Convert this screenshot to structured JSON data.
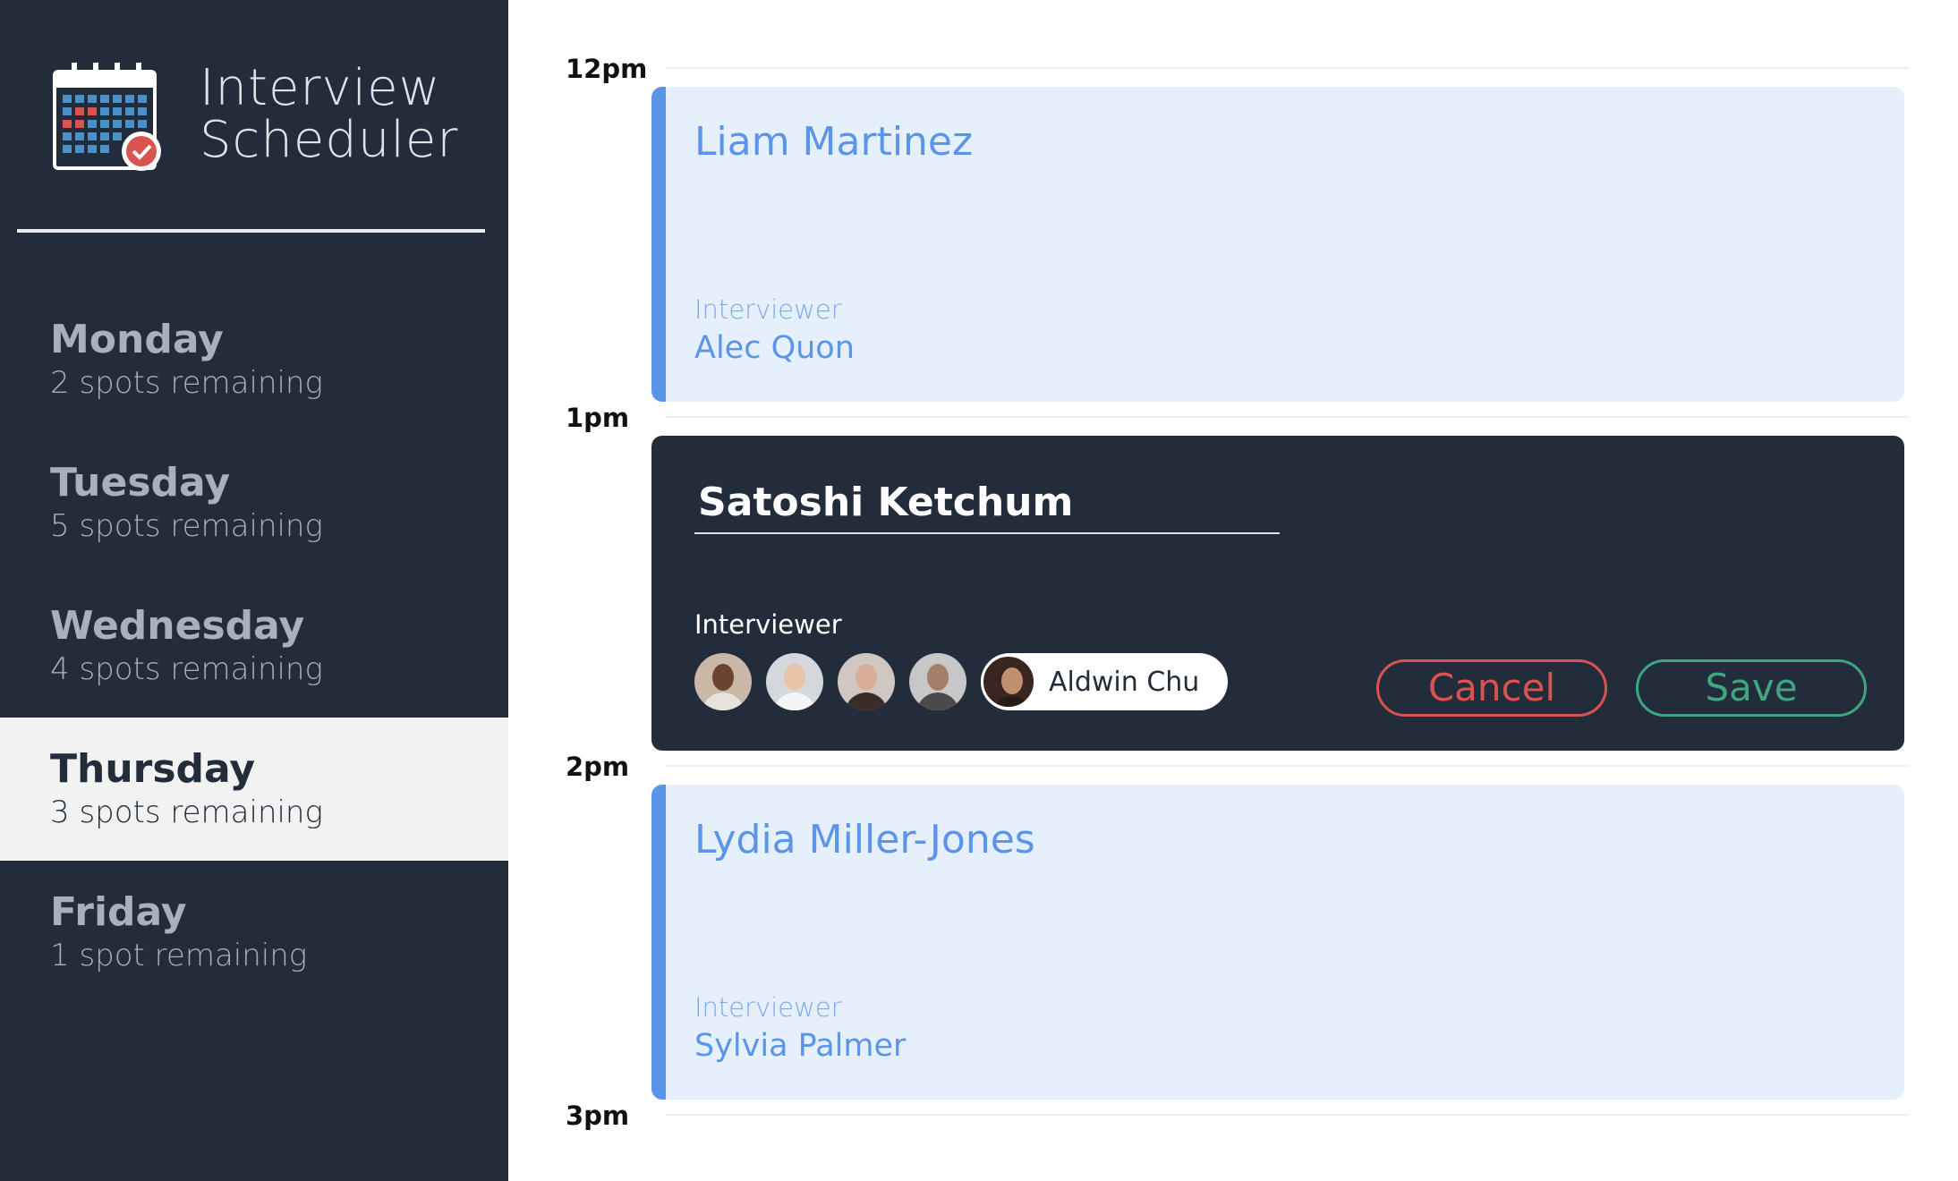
{
  "app": {
    "title_line1": "Interview",
    "title_line2": "Scheduler"
  },
  "days": [
    {
      "name": "Monday",
      "spots": "2 spots remaining",
      "selected": false
    },
    {
      "name": "Tuesday",
      "spots": "5 spots remaining",
      "selected": false
    },
    {
      "name": "Wednesday",
      "spots": "4 spots remaining",
      "selected": false
    },
    {
      "name": "Thursday",
      "spots": "3 spots remaining",
      "selected": true
    },
    {
      "name": "Friday",
      "spots": "1 spot remaining",
      "selected": false
    }
  ],
  "times": [
    "12pm",
    "1pm",
    "2pm",
    "3pm"
  ],
  "appointments": {
    "first": {
      "student": "Liam Martinez",
      "interviewer_label": "Interviewer",
      "interviewer": "Alec Quon"
    },
    "edit": {
      "student_value": "Satoshi Ketchum",
      "interviewer_label": "Interviewer",
      "selected_interviewer": "Aldwin Chu",
      "cancel_label": "Cancel",
      "save_label": "Save"
    },
    "third": {
      "student": "Lydia Miller-Jones",
      "interviewer_label": "Interviewer",
      "interviewer": "Sylvia Palmer"
    }
  },
  "colors": {
    "sidebar": "#232c3b",
    "accent": "#5b95ea",
    "booked_bg": "#e6f0fd",
    "cancel": "#d9534f",
    "save": "#3fa780"
  }
}
